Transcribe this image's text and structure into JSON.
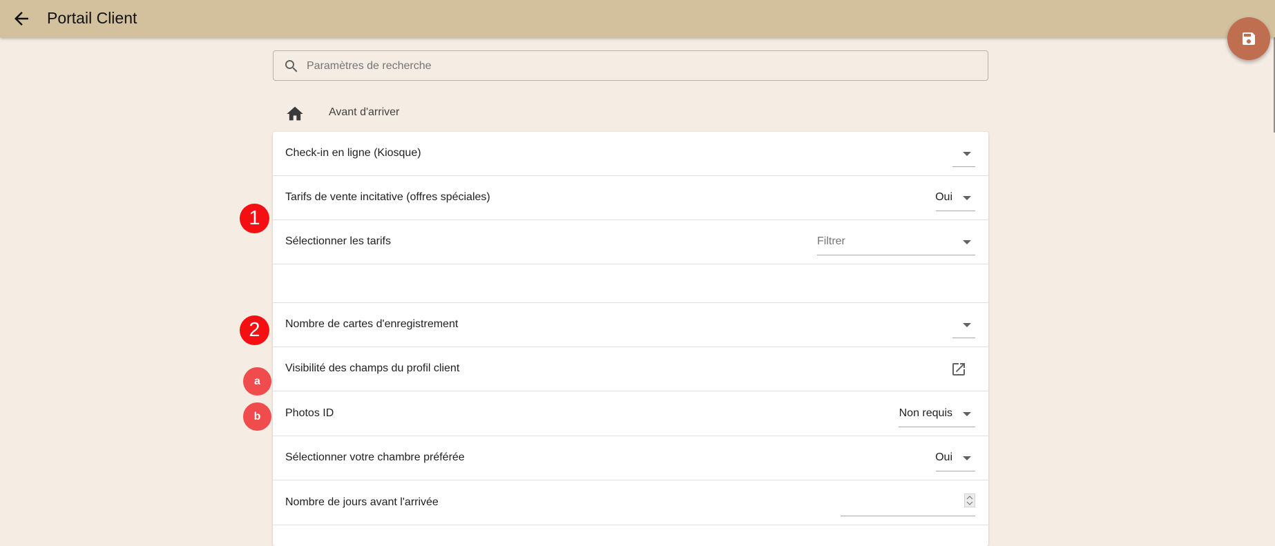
{
  "header": {
    "title": "Portail Client",
    "back_icon": "arrow-back-icon",
    "color": "#d3c19d"
  },
  "fab": {
    "icon": "save-icon",
    "color": "#bf6e50"
  },
  "search": {
    "placeholder": "Paramètres de recherche",
    "value": ""
  },
  "breadcrumb": {
    "home_icon": "home-icon",
    "label": "Avant d'arriver"
  },
  "settings": {
    "checkin": {
      "label": "Check-in en ligne (Kiosque)",
      "value": ""
    },
    "upsell": {
      "label": "Tarifs de vente incitative (offres spéciales)",
      "value": "Oui"
    },
    "rates": {
      "label": "Sélectionner les tarifs",
      "placeholder": "Filtrer"
    },
    "cards": {
      "label": "Nombre de cartes d'enregistrement",
      "value": ""
    },
    "visibility": {
      "label": "Visibilité des champs du profil client",
      "icon": "open-in-new-icon"
    },
    "photos": {
      "label": "Photos ID",
      "value": "Non requis"
    },
    "room": {
      "label": "Sélectionner votre chambre préférée",
      "value": "Oui"
    },
    "days": {
      "label": "Nombre de jours avant l'arrivée",
      "value": ""
    }
  },
  "markers": {
    "m1": "1",
    "m2": "2",
    "ma": "a",
    "mb": "b",
    "big_color": "#f50f12",
    "small_color": "#f04b4d"
  }
}
